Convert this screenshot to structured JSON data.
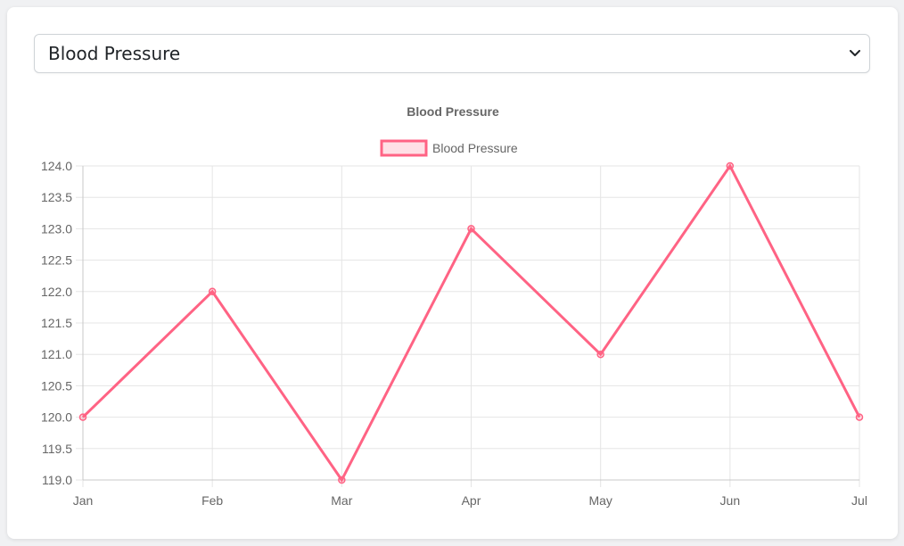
{
  "selector": {
    "selected": "Blood Pressure"
  },
  "colors": {
    "series": "#ff6384",
    "series_fill": "rgba(255,99,132,0.2)",
    "grid": "#e5e5e5",
    "text": "#666666"
  },
  "chart_data": {
    "type": "line",
    "title": "Blood Pressure",
    "categories": [
      "Jan",
      "Feb",
      "Mar",
      "Apr",
      "May",
      "Jun",
      "Jul"
    ],
    "series": [
      {
        "name": "Blood Pressure",
        "values": [
          120,
          122,
          119,
          123,
          121,
          124,
          120
        ]
      }
    ],
    "ylim": [
      119,
      124
    ],
    "ytick_step": 0.5,
    "ytick_labels": [
      "124.0",
      "123.5",
      "123.0",
      "122.5",
      "122.0",
      "121.5",
      "121.0",
      "120.5",
      "120.0",
      "119.5",
      "119.0"
    ],
    "grid": true,
    "legend": "top-center"
  }
}
